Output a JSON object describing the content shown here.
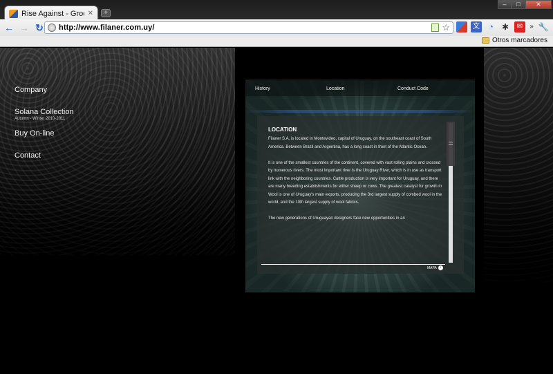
{
  "browser": {
    "tab_title": "Rise Against - Grooveshark",
    "tab_close": "✕",
    "new_tab": "+",
    "window_buttons": [
      "–",
      "□",
      "✕"
    ],
    "url": "http://www.filaner.com.uy/",
    "bookmarks_other": "Otros marcadores",
    "icons": [
      "back-icon",
      "forward-icon",
      "reload-icon",
      "globe-icon",
      "page-icon",
      "star-icon",
      "extension-icons",
      "wrench-icon"
    ]
  },
  "site": {
    "nav": {
      "company": "Company",
      "solana": "Solana Collection",
      "solana_sub": "Autumn - Winter 2010-2011",
      "buy": "Buy On-line",
      "contact": "Contact"
    },
    "tabs": {
      "history": "History",
      "location": "Location",
      "conduct": "Conduct Code"
    },
    "content": {
      "title": "LOCATION",
      "p1": "Filaner S.A. is located in Montevideo, capital of Uruguay, on the southeast coast of South America. Between Brazil and Argentina, has a long coast in front of the Atlantic Ocean.",
      "p2": "It is one of the smallest countries of the continent, covered with vast rolling plains and crossed by numerous rivers. The most important river is the Uruguay River, which is in use as transport link with the neighboring countries. Cattle production is very important for Uruguay, and there are many breeding establishments for either sheep or cows. The greatest catalyst for growth in Wool is one of Uruguay's main exports, producing the 3rd largest supply of combed wool in the world, and the 10th largest supply of wool fabrics.",
      "p3": "The new generations of Uruguayan designers face new opportunities in an",
      "mapa": "MAPA"
    }
  }
}
